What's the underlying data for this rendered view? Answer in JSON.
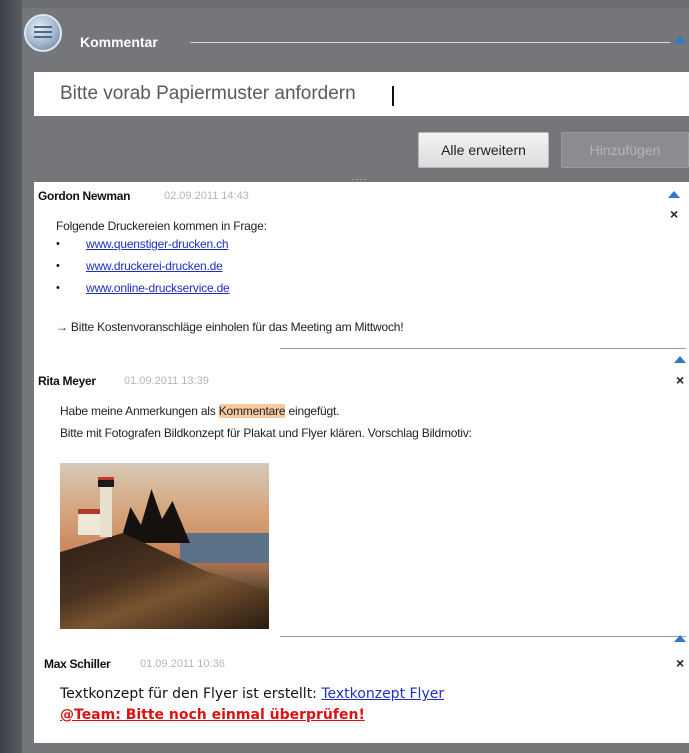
{
  "header": {
    "title": "Kommentar",
    "icon": "speech-bubble-icon"
  },
  "input": {
    "value": "Bitte vorab Papiermuster anfordern"
  },
  "buttons": {
    "expand_all": "Alle erweitern",
    "add": "Hinzufügen"
  },
  "resize_handle": "....",
  "comments": [
    {
      "author": "Gordon Newman",
      "timestamp": "02.09.2011 14:43",
      "intro": "Folgende Druckereien kommen in Frage:",
      "links": [
        "www.quenstiger-drucken.ch",
        "www.druckerei-drucken.de",
        "www.online-druckservice.de"
      ],
      "bullet": "•",
      "note": "→ Bitte Kostenvoranschläge einholen für das Meeting am Mittwoch!"
    },
    {
      "author": "Rita Meyer",
      "timestamp": "01.09.2011 13:39",
      "line1_before": "Habe meine Anmerkungen als ",
      "line1_highlight": "Kommentare",
      "line1_after": " eingefügt.",
      "line2": "Bitte mit Fotografen Bildkonzept für Plakat und Flyer klären. Vorschlag Bildmotiv:"
    },
    {
      "author": "Max Schiller",
      "timestamp": "01.09.2011 10:36",
      "text": "Textkonzept für den Flyer ist erstellt: ",
      "link": "Textkonzept Flyer",
      "mention": "@Team: Bitte noch einmal überprüfen!"
    }
  ],
  "close_symbol": "×",
  "colors": {
    "accent": "#2f77c9",
    "link": "#1f2fbf",
    "highlight": "#f7c9a0",
    "mention": "#dd1111"
  }
}
